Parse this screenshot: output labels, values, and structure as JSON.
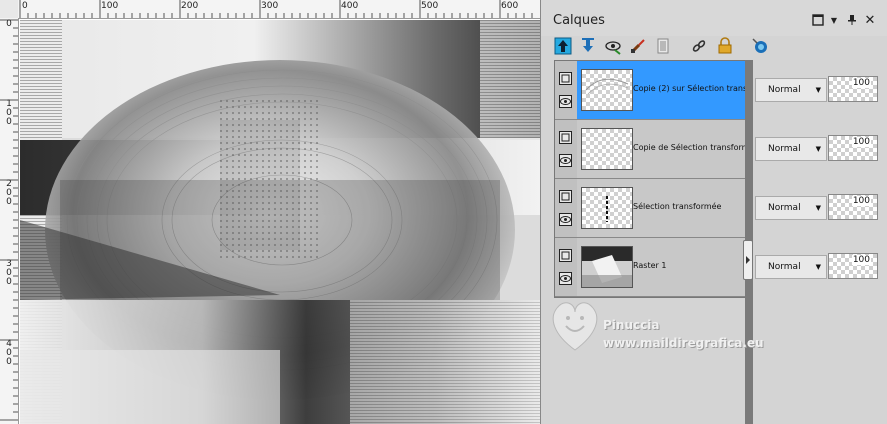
{
  "rulers": {
    "top": [
      "0",
      "100",
      "200",
      "300",
      "400",
      "500",
      "600"
    ],
    "left": [
      "0",
      "100",
      "200",
      "300",
      "400"
    ]
  },
  "panel": {
    "title": "Calques",
    "header_icons": [
      "maximize-icon",
      "chevron-down-icon",
      "pin-icon",
      "close-icon"
    ],
    "toolbar_icons": [
      "move-layer-up-icon",
      "move-layer-down-icon",
      "eye-toggle-icon",
      "paint-brush-icon",
      "mask-icon",
      "link-icon",
      "lock-icon",
      "blend-circle-icon"
    ]
  },
  "layers": [
    {
      "name": "Copie (2) sur Sélection transf",
      "blend_mode": "Normal",
      "opacity": "100",
      "selected": true
    },
    {
      "name": "Copie de Sélection transform",
      "blend_mode": "Normal",
      "opacity": "100",
      "selected": false
    },
    {
      "name": "Sélection transformée",
      "blend_mode": "Normal",
      "opacity": "100",
      "selected": false
    },
    {
      "name": "Raster 1",
      "blend_mode": "Normal",
      "opacity": "100",
      "selected": false
    }
  ],
  "watermark": {
    "name": "Pinuccia",
    "url": "www.maildiregrafica.eu"
  },
  "colors": {
    "selection": "#3399ff",
    "panel_bg": "#d4d4d4"
  }
}
